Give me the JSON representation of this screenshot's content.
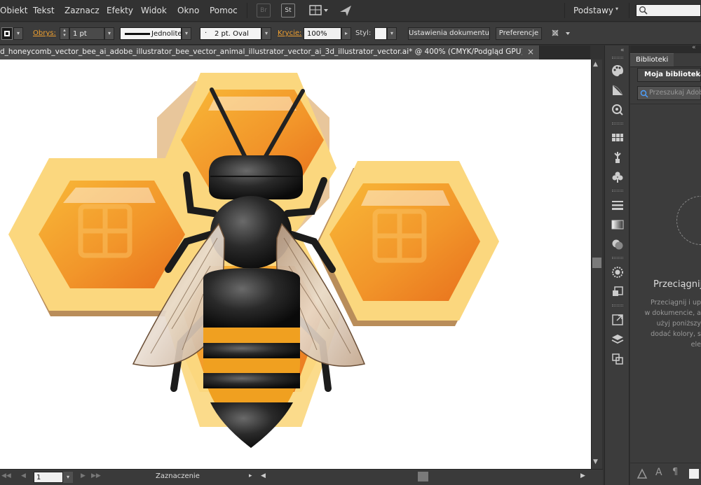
{
  "menu": {
    "items": [
      "Obiekt",
      "Tekst",
      "Zaznacz",
      "Efekty",
      "Widok",
      "Okno",
      "Pomoc"
    ],
    "bridge": "Br",
    "stock": "St",
    "workspace": "Podstawy"
  },
  "control": {
    "stroke_label": "Obrys:",
    "stroke_weight": "1 pt",
    "line_style": "Jednolite",
    "brush": "2 pt. Oval",
    "opacity_label": "Krycie:",
    "opacity": "100%",
    "style_label": "Styl:",
    "doc_setup": "Ustawienia dokumentu",
    "preferences": "Preferencje"
  },
  "document": {
    "tab_title": "d_honeycomb_vector_bee_ai_adobe_illustrator_bee_vector_animal_illustrator_vector_ai_3d_illustrator_vector.ai* @ 400% (CMYK/Podgląd GPU)",
    "close": "×"
  },
  "status": {
    "artboard": "1",
    "tool": "Zaznaczenie"
  },
  "library": {
    "tab": "Biblioteki",
    "collapse": "«",
    "library_name": "Moja biblioteka",
    "search_placeholder": "Przeszukaj Adobe",
    "drag_title": "Przeciągnij",
    "drag_text": [
      "Przeciągnij i up",
      "w dokumencie, a",
      "użyj poniższy",
      "dodać kolory, s",
      "ele"
    ]
  },
  "colors": {
    "accent_orange": "#f0a030",
    "honey_light": "#fbd77e",
    "honey_dark": "#e8781c"
  }
}
